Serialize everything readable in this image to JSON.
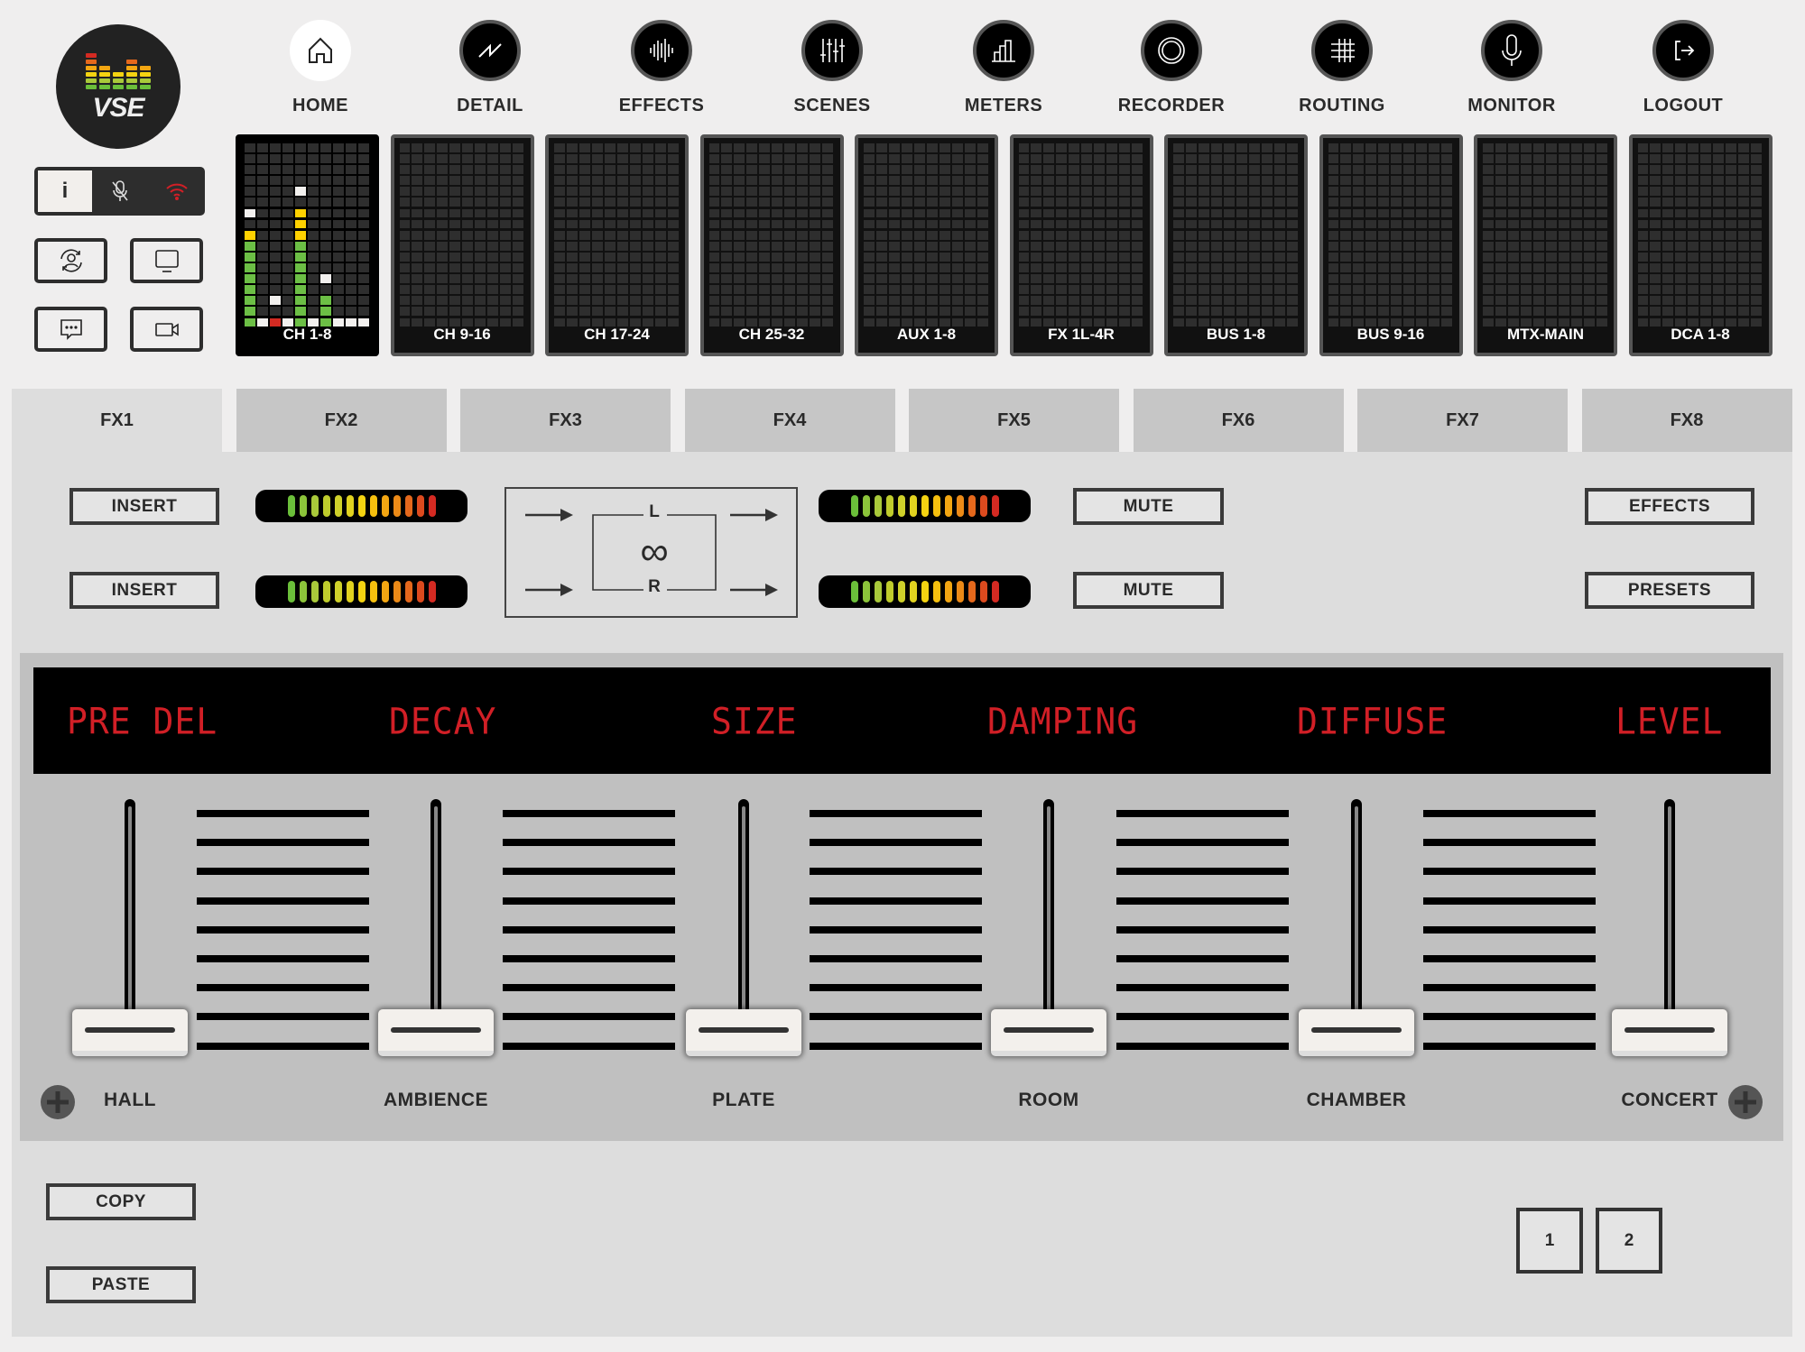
{
  "logo": {
    "text": "VSE"
  },
  "status": {
    "info_label": "i",
    "icons": [
      "info-icon",
      "mic-muted-icon",
      "wifi-icon"
    ]
  },
  "side_buttons": [
    "sync-user-icon",
    "monitor-screen-icon",
    "chat-icon",
    "video-camera-icon"
  ],
  "nav": [
    {
      "label": "HOME",
      "icon": "home-icon"
    },
    {
      "label": "DETAIL",
      "icon": "waveform-icon"
    },
    {
      "label": "EFFECTS",
      "icon": "effects-icon"
    },
    {
      "label": "SCENES",
      "icon": "sliders-icon"
    },
    {
      "label": "METERS",
      "icon": "bar-chart-icon"
    },
    {
      "label": "RECORDER",
      "icon": "record-icon"
    },
    {
      "label": "ROUTING",
      "icon": "grid-icon"
    },
    {
      "label": "MONITOR",
      "icon": "microphone-icon"
    },
    {
      "label": "LOGOUT",
      "icon": "logout-icon"
    }
  ],
  "meter_tiles": [
    {
      "label": "CH 1-8",
      "active": true,
      "levels": [
        9,
        1,
        1,
        1,
        11,
        1,
        3,
        1,
        1,
        1
      ],
      "peaks": [
        10,
        null,
        2,
        null,
        12,
        null,
        4,
        null,
        null,
        null
      ],
      "bottom_colors": [
        "green",
        "white",
        "red",
        "white",
        "green",
        "white",
        "green",
        "white",
        "white",
        "white"
      ]
    },
    {
      "label": "CH 9-16"
    },
    {
      "label": "CH 17-24"
    },
    {
      "label": "CH 25-32"
    },
    {
      "label": "AUX 1-8"
    },
    {
      "label": "FX 1L-4R"
    },
    {
      "label": "BUS 1-8"
    },
    {
      "label": "BUS 9-16"
    },
    {
      "label": "MTX-MAIN"
    },
    {
      "label": "DCA 1-8"
    }
  ],
  "tabs": [
    "FX1",
    "FX2",
    "FX3",
    "FX4",
    "FX5",
    "FX6",
    "FX7",
    "FX8"
  ],
  "active_tab": "FX1",
  "fx": {
    "insert_labels": [
      "INSERT",
      "INSERT"
    ],
    "mute_labels": [
      "MUTE",
      "MUTE"
    ],
    "effects_label": "EFFECTS",
    "presets_label": "PRESETS",
    "diagram": {
      "left": "L",
      "right": "R",
      "symbol": "∞"
    },
    "meter_colors": [
      "#6bbf3a",
      "#8cc43a",
      "#a9c93a",
      "#bfcc2c",
      "#cfd12a",
      "#e1d21f",
      "#f4d311",
      "#f6c00e",
      "#f3a612",
      "#ec8a17",
      "#e5681c",
      "#dc4a1e",
      "#d42a22"
    ]
  },
  "params": [
    "PRE DEL",
    "DECAY",
    "SIZE",
    "DAMPING",
    "DIFFUSE",
    "LEVEL"
  ],
  "presets": [
    "HALL",
    "AMBIENCE",
    "PLATE",
    "ROOM",
    "CHAMBER",
    "CONCERT"
  ],
  "fader_positions": [
    0,
    0,
    0,
    0,
    0,
    0
  ],
  "bottom": {
    "copy": "COPY",
    "paste": "PASTE",
    "pages": [
      "1",
      "2"
    ]
  },
  "colors": {
    "led_red": "#d11f26",
    "green": "#6cbf45",
    "yellow": "#ffd200",
    "red": "#d42a22"
  }
}
